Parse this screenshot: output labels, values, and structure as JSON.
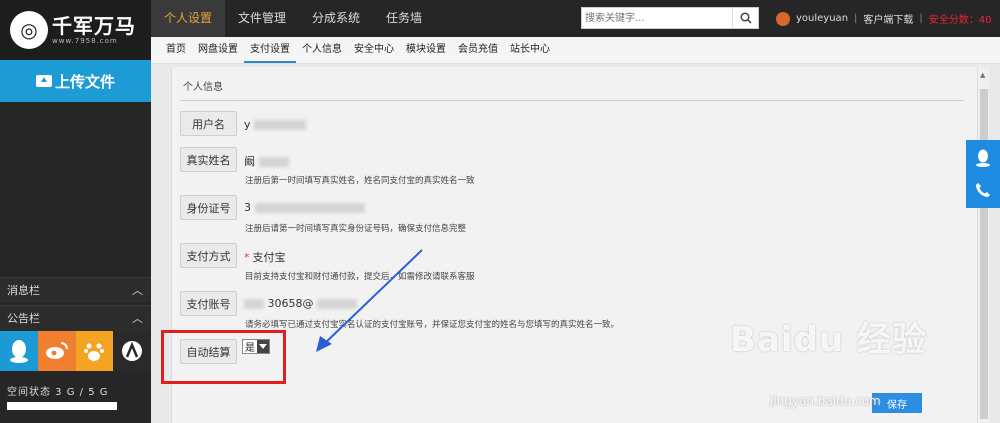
{
  "brand": {
    "name": "千军万马",
    "url": "www.7958.com"
  },
  "sidebar": {
    "upload_label": "上传文件",
    "panels": [
      {
        "label": "消息栏"
      },
      {
        "label": "公告栏"
      }
    ],
    "social_icons": [
      "qq-icon",
      "weibo-icon",
      "baidu-icon",
      "other-social-icon"
    ],
    "space_status": "空间状态  3 G / 5 G",
    "space_usage": 0.6
  },
  "topnav": {
    "tabs": [
      "个人设置",
      "文件管理",
      "分成系统",
      "任务墙"
    ],
    "active_tab": "个人设置",
    "search_placeholder": "搜索关键字...",
    "username": "youleyuan",
    "client_download": "客户端下载",
    "safety_score": "安全分数：40"
  },
  "subnav": {
    "items": [
      "首页",
      "网盘设置",
      "支付设置",
      "个人信息",
      "安全中心",
      "模块设置",
      "会员充值",
      "站长中心"
    ],
    "active": "支付设置"
  },
  "form": {
    "section_title": "个人信息",
    "fields": {
      "username_label": "用户名",
      "username_value": "y",
      "realname_label": "真实姓名",
      "realname_value": "阚",
      "realname_hint": "注册后第一时间填写真实姓名，姓名同支付宝的真实姓名一致",
      "idcard_label": "身份证号",
      "idcard_value": "3",
      "idcard_hint": "注册后请第一时间填写真实身份证号码，确保支付信息完整",
      "paymethod_label": "支付方式",
      "paymethod_value": "支付宝",
      "paymethod_hint": "目前支持支付宝和财付通付款，提交后，如需修改请联系客服",
      "account_label": "支付账号",
      "account_value": "30658@",
      "account_hint": "请务必填写已通过支付宝实名认证的支付宝账号，并保证您支付宝的姓名与您填写的真实姓名一致。",
      "autosettle_label": "自动结算",
      "autosettle_value": "是"
    },
    "save_label": "保存"
  },
  "watermark": {
    "text": "Baidu 经验",
    "url": "jingyan.baidu.com"
  },
  "colors": {
    "accent": "#1d9bd4",
    "highlight": "#e02020",
    "arrow": "#2b5fd8"
  }
}
